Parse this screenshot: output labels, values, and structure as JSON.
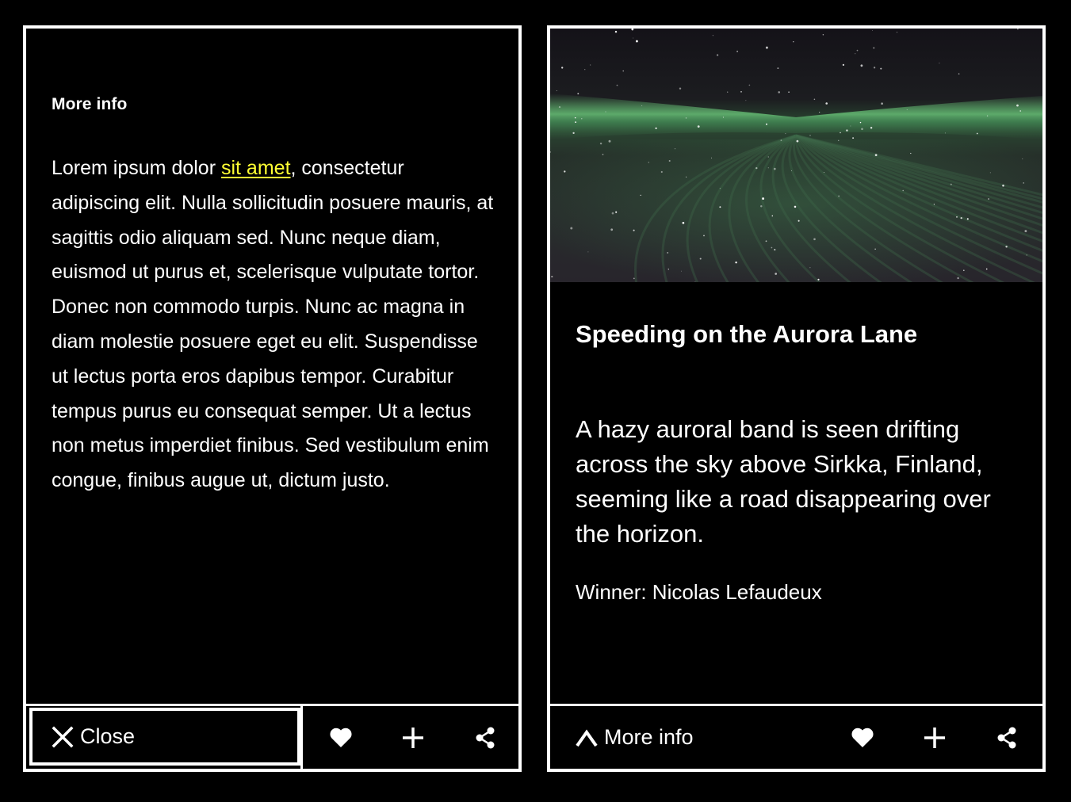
{
  "left_card": {
    "heading": "More info",
    "body_before_link": "Lorem ipsum dolor ",
    "body_link": "sit amet",
    "body_after_link": ", consectetur adipiscing elit. Nulla sollicitudin posuere mauris, at sagittis odio aliquam sed. Nunc neque diam, euismod ut purus et, scelerisque vulputate tortor. Donec non commodo turpis. Nunc ac magna in diam molestie posuere eget eu elit. Suspendisse ut lectus porta eros dapibus tempor. Curabitur tempus purus eu consequat semper. Ut a lectus non metus imperdiet finibus. Sed vestibulum enim congue, finibus augue ut, dictum justo.",
    "close_label": "Close"
  },
  "right_card": {
    "title": "Speeding on the Aurora Lane",
    "description": "A hazy auroral band is seen drifting across the sky above Sirkka, Finland, seeming like a road disappearing over the horizon.",
    "credit": "Winner: Nicolas Lefaudeux",
    "more_info_label": "More info"
  },
  "icons": {
    "close": "close-icon",
    "like": "heart-icon",
    "add": "plus-icon",
    "share": "share-icon",
    "expand": "chevron-up-icon"
  },
  "colors": {
    "background": "#000000",
    "text": "#ffffff",
    "link": "#ffff33",
    "aurora": "#6fd07f"
  }
}
